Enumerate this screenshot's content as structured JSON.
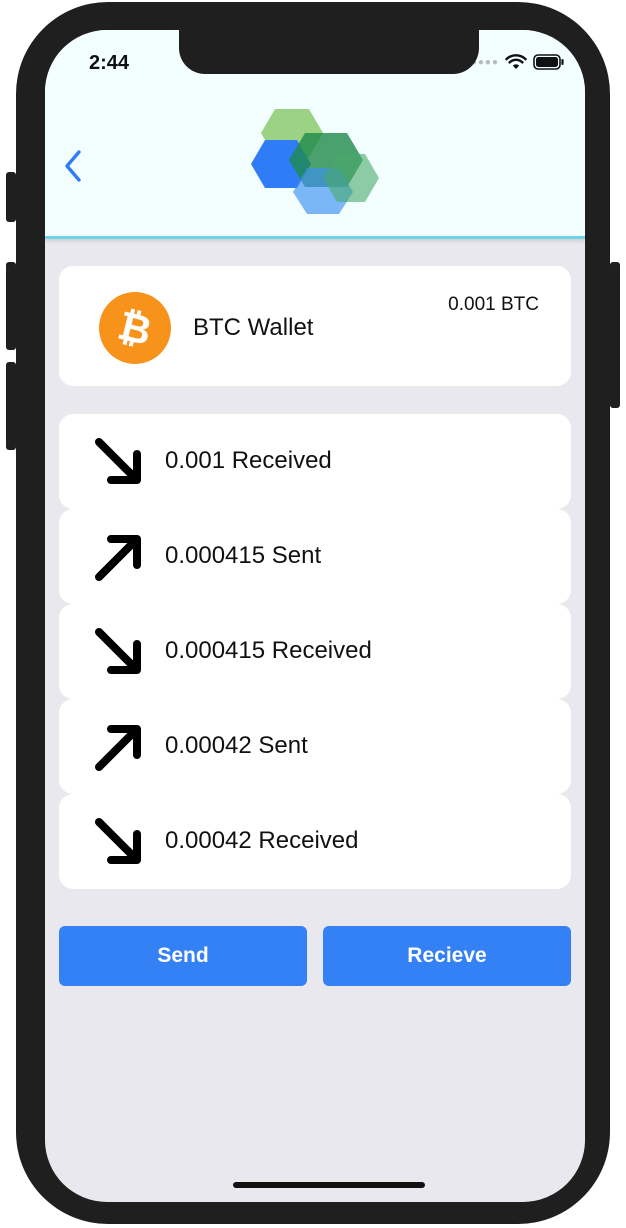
{
  "status_bar": {
    "time": "2:44",
    "icons": [
      "signal-dots-icon",
      "wifi-icon",
      "battery-icon"
    ]
  },
  "header": {
    "back_icon": "chevron-left-icon",
    "logo": "hexagon-logo",
    "accent_color": "#6fd3e8"
  },
  "wallet": {
    "name": "BTC Wallet",
    "balance": "0.001 BTC",
    "icon": "bitcoin-icon",
    "icon_color": "#f7931a"
  },
  "transactions": [
    {
      "label": "0.001 Received",
      "direction": "received",
      "icon": "arrow-down-right-icon"
    },
    {
      "label": "0.000415 Sent",
      "direction": "sent",
      "icon": "arrow-up-right-icon"
    },
    {
      "label": "0.000415 Received",
      "direction": "received",
      "icon": "arrow-down-right-icon"
    },
    {
      "label": "0.00042 Sent",
      "direction": "sent",
      "icon": "arrow-up-right-icon"
    },
    {
      "label": "0.00042 Received",
      "direction": "received",
      "icon": "arrow-down-right-icon"
    }
  ],
  "actions": {
    "send_label": "Send",
    "receive_label": "Recieve",
    "button_color": "#3480f5"
  }
}
